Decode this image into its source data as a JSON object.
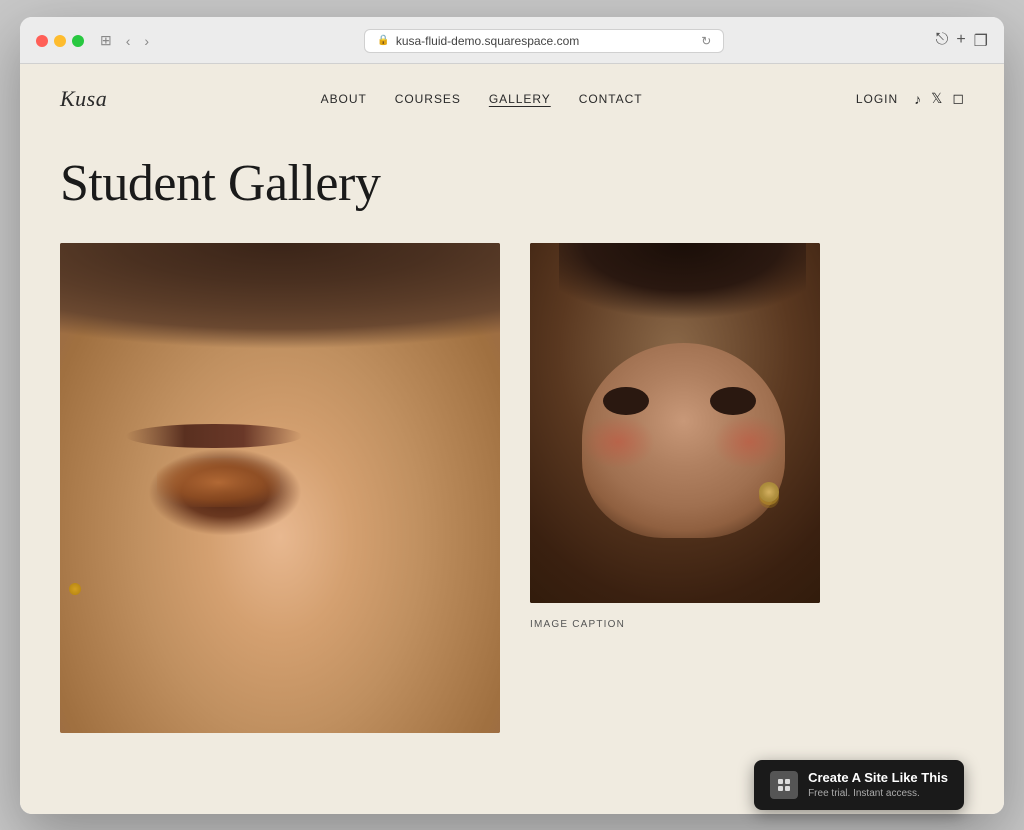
{
  "browser": {
    "url": "kusa-fluid-demo.squarespace.com",
    "back_label": "‹",
    "forward_label": "›",
    "window_icon": "⊞"
  },
  "nav": {
    "logo": "Kusa",
    "links": [
      {
        "label": "ABOUT",
        "active": false
      },
      {
        "label": "COURSES",
        "active": false
      },
      {
        "label": "GALLERY",
        "active": true
      },
      {
        "label": "CONTACT",
        "active": false
      }
    ],
    "login": "LOGIN",
    "socials": [
      "tiktok",
      "twitter",
      "instagram"
    ]
  },
  "page": {
    "title": "Student Gallery"
  },
  "gallery": {
    "image_caption": "IMAGE CAPTION"
  },
  "squarespace_banner": {
    "cta": "Create A Site Like This",
    "sub": "Free trial. Instant access."
  }
}
